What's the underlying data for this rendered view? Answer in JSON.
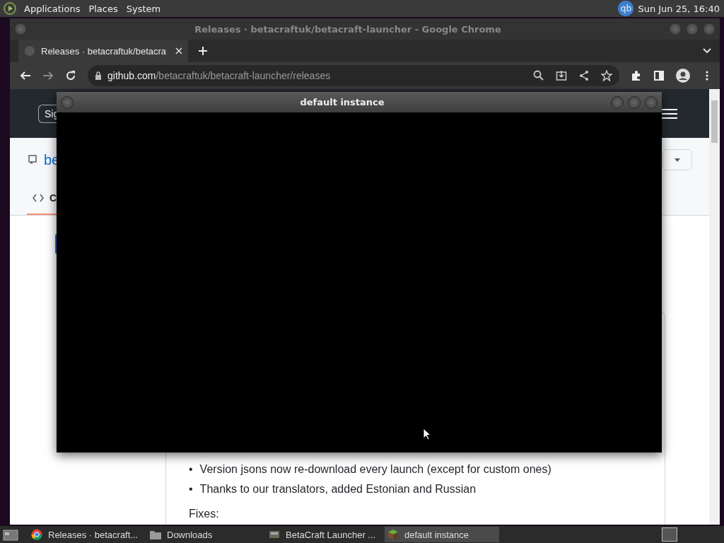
{
  "top_panel": {
    "menus": [
      "Applications",
      "Places",
      "System"
    ],
    "tray_badge": "qb",
    "clock": "Sun Jun 25, 16:40"
  },
  "browser": {
    "title": "Releases · betacraftuk/betacraft-launcher - Google Chrome",
    "tabs": [
      {
        "label": "Releases · betacraftuk/betacra",
        "selected": true
      }
    ],
    "url": {
      "host": "github.com",
      "path": "/betacraftuk/betacraft-launcher/releases"
    },
    "page": {
      "sign_button": "Sig",
      "repo_link": "be",
      "tab_label": "C",
      "release_notes": [
        {
          "bullet": "•",
          "text": "Version jsons now re-download every launch (except for custom ones)"
        },
        {
          "bullet": "•",
          "text": "Thanks to our translators, added Estonian and Russian"
        }
      ],
      "section_heading": "Fixes:"
    }
  },
  "overlay_window": {
    "title": "default instance"
  },
  "taskbar": {
    "items": [
      {
        "label": "Releases · betacraft...",
        "kind": "browser",
        "selected": false
      },
      {
        "label": "Downloads",
        "kind": "folder",
        "selected": false
      },
      {
        "label": "BetaCraft Launcher ...",
        "kind": "launcher",
        "selected": false
      },
      {
        "label": "default instance",
        "kind": "block",
        "selected": true
      }
    ]
  }
}
